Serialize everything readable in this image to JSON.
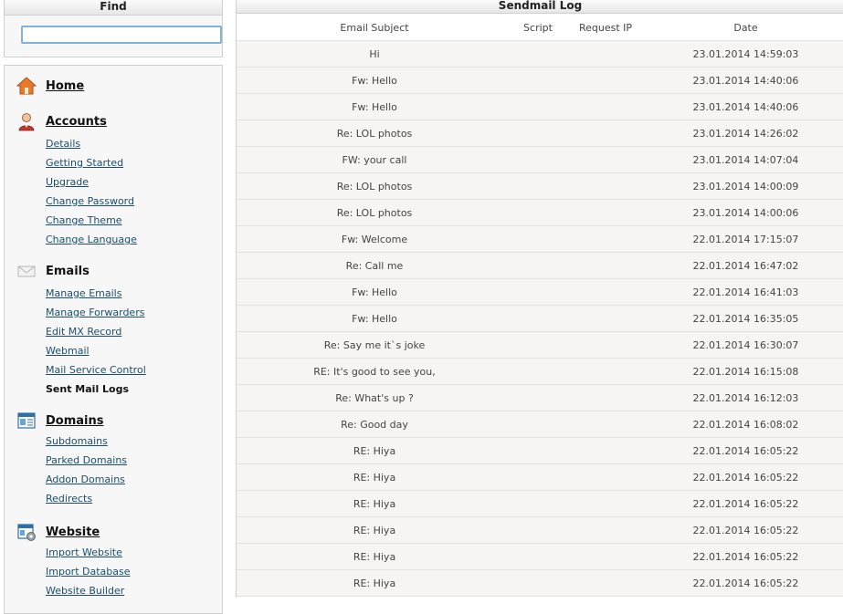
{
  "find": {
    "title": "Find",
    "search_value": "",
    "search_placeholder": ""
  },
  "nav": {
    "home": {
      "label": "Home",
      "icon": "home-icon"
    },
    "accounts": {
      "label": "Accounts",
      "icon": "user-icon",
      "items": [
        "Details",
        "Getting Started",
        "Upgrade",
        "Change Password",
        "Change Theme",
        "Change Language"
      ]
    },
    "emails": {
      "label": "Emails",
      "icon": "envelope-icon",
      "items": [
        "Manage Emails",
        "Manage Forwarders",
        "Edit MX Record",
        "Webmail",
        "Mail Service Control",
        "Sent Mail Logs"
      ],
      "active_item": "Sent Mail Logs"
    },
    "domains": {
      "label": "Domains",
      "icon": "domain-icon",
      "items": [
        "Subdomains",
        "Parked Domains",
        "Addon Domains",
        "Redirects"
      ]
    },
    "website": {
      "label": "Website",
      "icon": "website-settings-icon",
      "items": [
        "Import Website",
        "Import Database",
        "Website Builder"
      ]
    }
  },
  "log": {
    "title": "Sendmail Log",
    "columns": {
      "subject": "Email Subject",
      "script": "Script",
      "ip": "Request IP",
      "date": "Date"
    },
    "rows": [
      {
        "subject": "Hi",
        "script": "",
        "ip": "",
        "date": "23.01.2014 14:59:03"
      },
      {
        "subject": "Fw: Hello",
        "script": "",
        "ip": "",
        "date": "23.01.2014 14:40:06"
      },
      {
        "subject": "Fw: Hello",
        "script": "",
        "ip": "",
        "date": "23.01.2014 14:40:06"
      },
      {
        "subject": "Re: LOL photos",
        "script": "",
        "ip": "",
        "date": "23.01.2014 14:26:02"
      },
      {
        "subject": "FW: your call",
        "script": "",
        "ip": "",
        "date": "23.01.2014 14:07:04"
      },
      {
        "subject": "Re: LOL photos",
        "script": "",
        "ip": "",
        "date": "23.01.2014 14:00:09"
      },
      {
        "subject": "Re: LOL photos",
        "script": "",
        "ip": "",
        "date": "23.01.2014 14:00:06"
      },
      {
        "subject": "Fw: Welcome",
        "script": "",
        "ip": "",
        "date": "22.01.2014 17:15:07"
      },
      {
        "subject": "Re: Call me",
        "script": "",
        "ip": "",
        "date": "22.01.2014 16:47:02"
      },
      {
        "subject": "Fw: Hello",
        "script": "",
        "ip": "",
        "date": "22.01.2014 16:41:03"
      },
      {
        "subject": "Fw: Hello",
        "script": "",
        "ip": "",
        "date": "22.01.2014 16:35:05"
      },
      {
        "subject": "Re: Say me it`s joke",
        "script": "",
        "ip": "",
        "date": "22.01.2014 16:30:07"
      },
      {
        "subject": "RE: It's good to see you,",
        "script": "",
        "ip": "",
        "date": "22.01.2014 16:15:08"
      },
      {
        "subject": "Re: What's up ?",
        "script": "",
        "ip": "",
        "date": "22.01.2014 16:12:03"
      },
      {
        "subject": "Re: Good day",
        "script": "",
        "ip": "",
        "date": "22.01.2014 16:08:02"
      },
      {
        "subject": "RE: Hiya",
        "script": "",
        "ip": "",
        "date": "22.01.2014 16:05:22"
      },
      {
        "subject": "RE: Hiya",
        "script": "",
        "ip": "",
        "date": "22.01.2014 16:05:22"
      },
      {
        "subject": "RE: Hiya",
        "script": "",
        "ip": "",
        "date": "22.01.2014 16:05:22"
      },
      {
        "subject": "RE: Hiya",
        "script": "",
        "ip": "",
        "date": "22.01.2014 16:05:22"
      },
      {
        "subject": "RE: Hiya",
        "script": "",
        "ip": "",
        "date": "22.01.2014 16:05:22"
      },
      {
        "subject": "RE: Hiya",
        "script": "",
        "ip": "",
        "date": "22.01.2014 16:05:22"
      }
    ]
  },
  "colors": {
    "link": "#1b4e6b",
    "row_background": "#f6f5f4",
    "search_border": "#7fb3de",
    "home_icon": "#e87a2a"
  }
}
